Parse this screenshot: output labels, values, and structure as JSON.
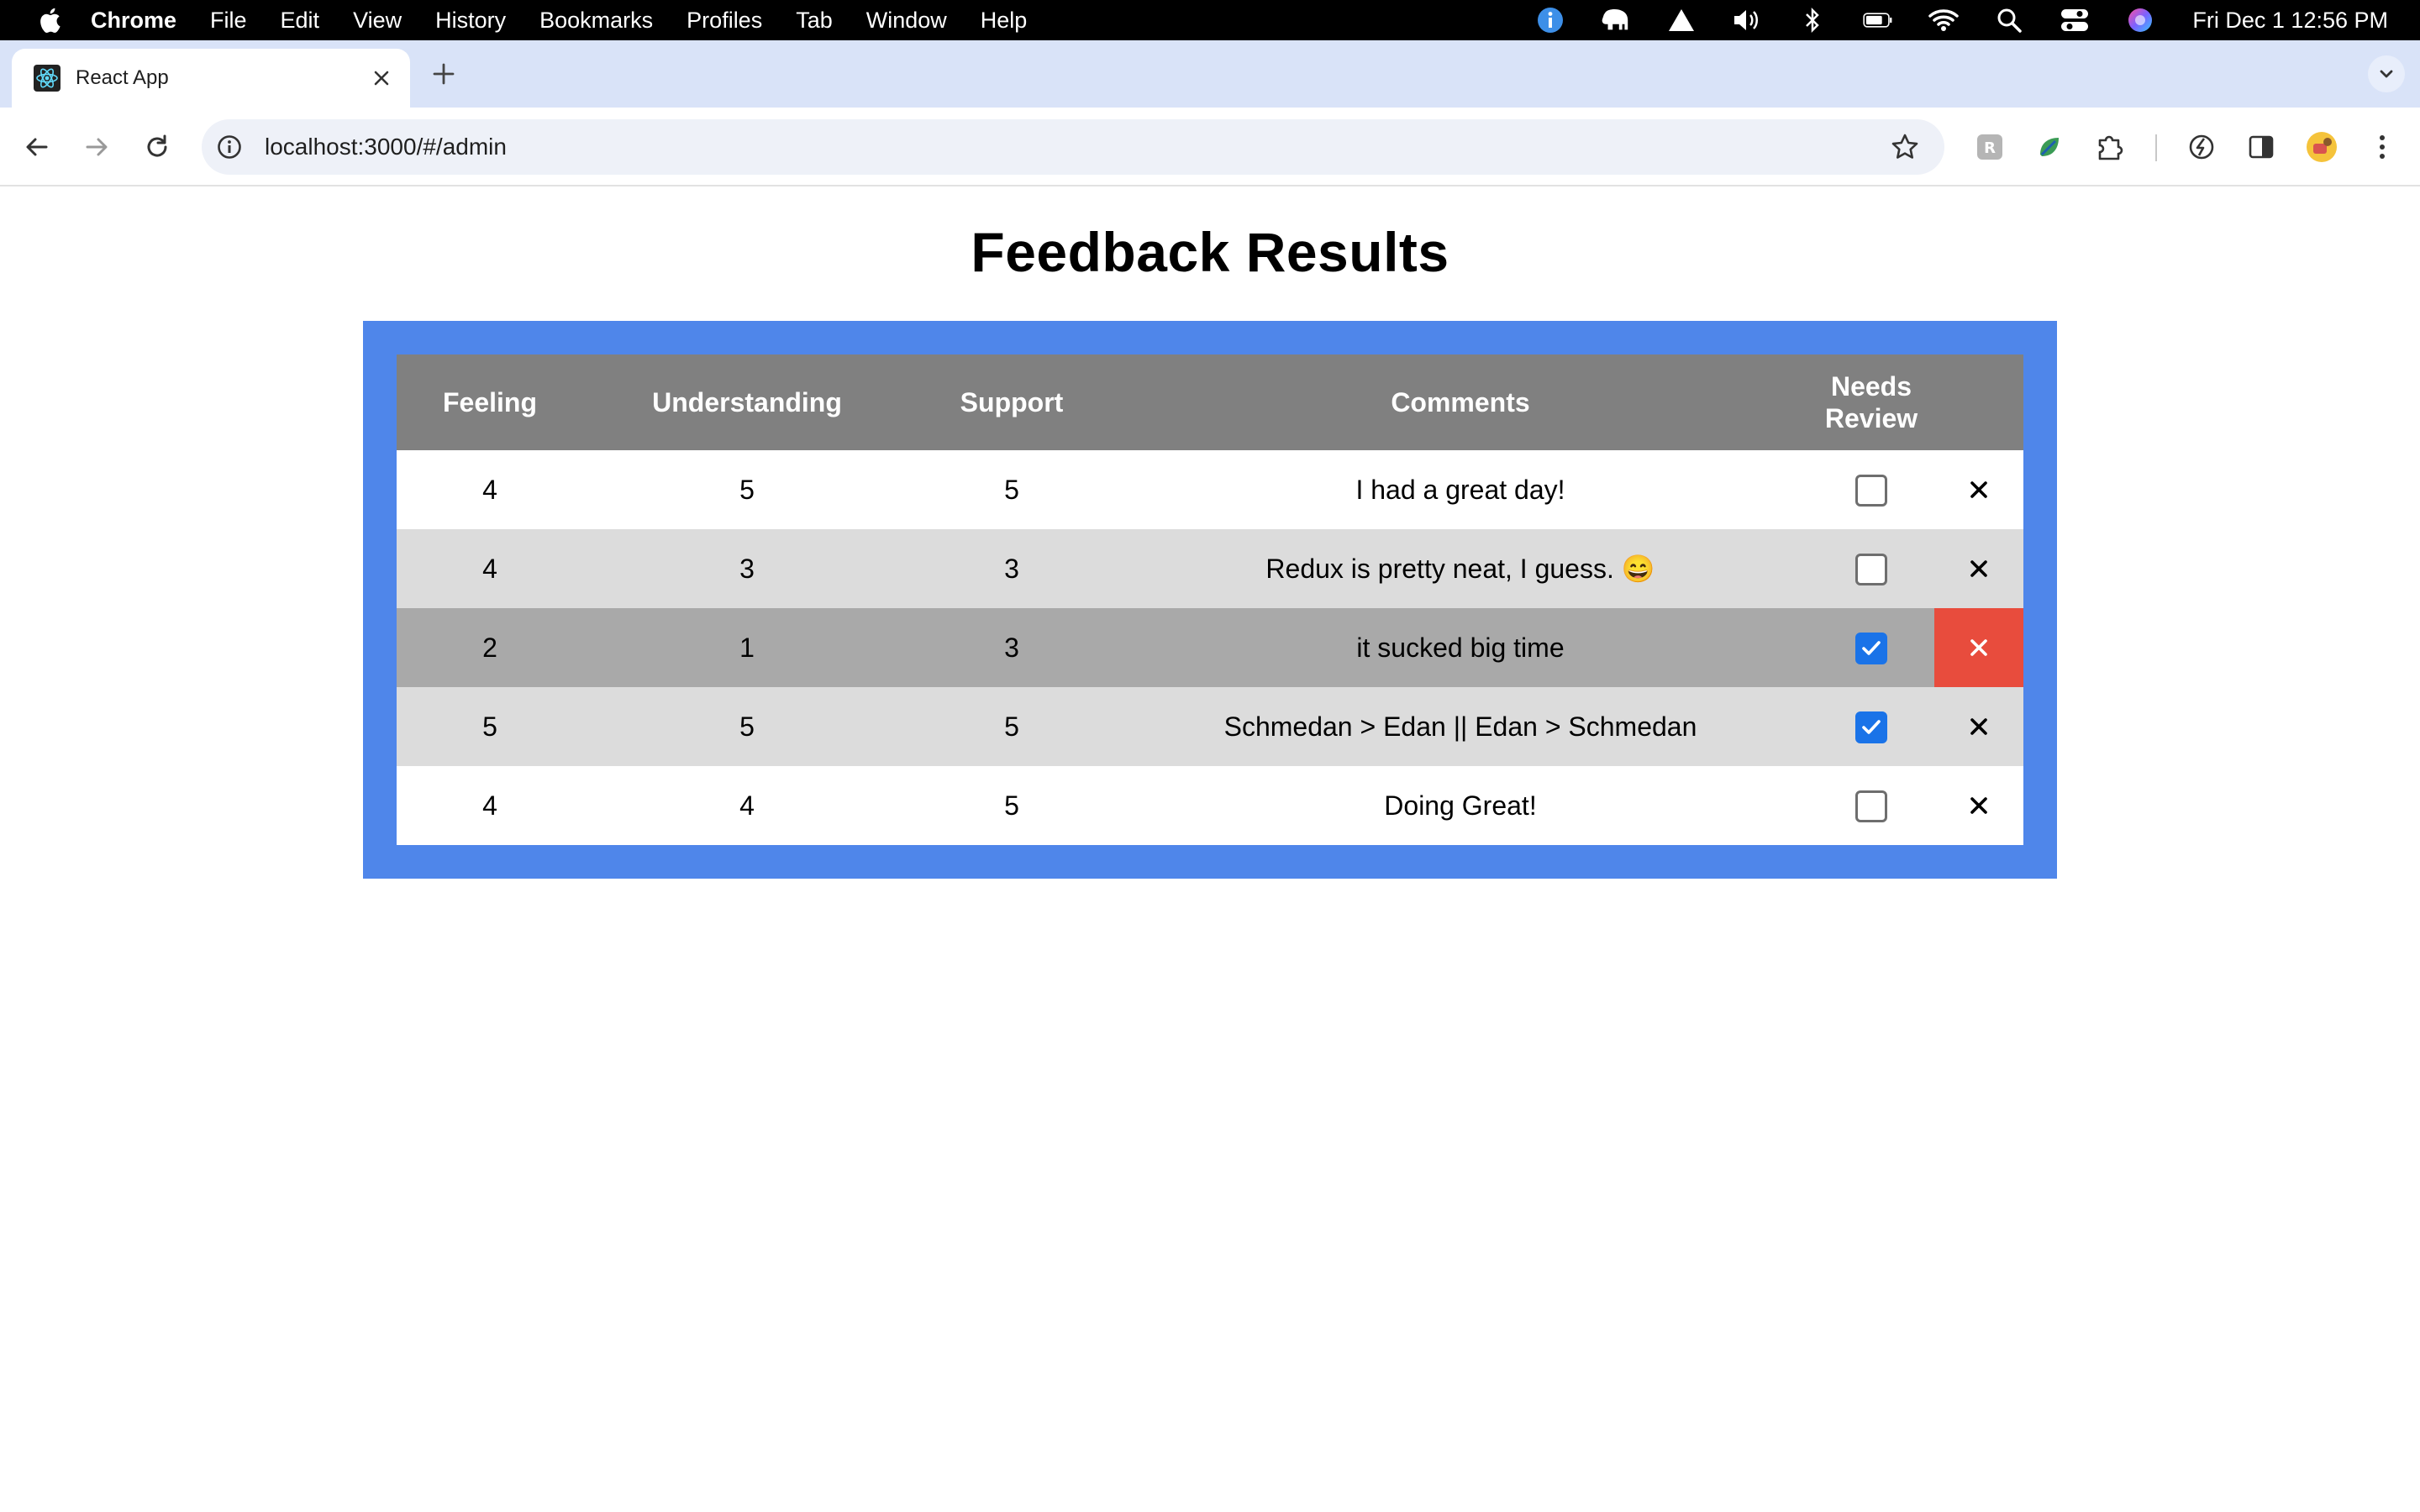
{
  "menubar": {
    "app_name": "Chrome",
    "items": [
      "File",
      "Edit",
      "View",
      "History",
      "Bookmarks",
      "Profiles",
      "Tab",
      "Window",
      "Help"
    ],
    "clock": "Fri Dec 1  12:56 PM"
  },
  "browser": {
    "tab_title": "React App",
    "url": "localhost:3000/#/admin"
  },
  "page": {
    "title": "Feedback Results"
  },
  "table": {
    "headers": {
      "feeling": "Feeling",
      "understanding": "Understanding",
      "support": "Support",
      "comments": "Comments",
      "needs_review_line1": "Needs",
      "needs_review_line2": "Review"
    },
    "rows": [
      {
        "feeling": "4",
        "understanding": "5",
        "support": "5",
        "comments": "I had a great day!",
        "needs_review": false
      },
      {
        "feeling": "4",
        "understanding": "3",
        "support": "3",
        "comments": "Redux is pretty neat, I guess. 😄",
        "needs_review": false
      },
      {
        "feeling": "2",
        "understanding": "1",
        "support": "3",
        "comments": "it sucked big time",
        "needs_review": true
      },
      {
        "feeling": "5",
        "understanding": "5",
        "support": "5",
        "comments": "Schmedan > Edan || Edan > Schmedan",
        "needs_review": true
      },
      {
        "feeling": "4",
        "understanding": "4",
        "support": "5",
        "comments": "Doing Great!",
        "needs_review": false
      }
    ],
    "delete_symbol": "✕"
  },
  "colors": {
    "frame_blue": "#4f86ea",
    "header_gray": "#808080",
    "flagged_row": "#a9a9a9",
    "delete_hover_red": "#e84c3d",
    "checkbox_blue": "#1a73e8"
  }
}
